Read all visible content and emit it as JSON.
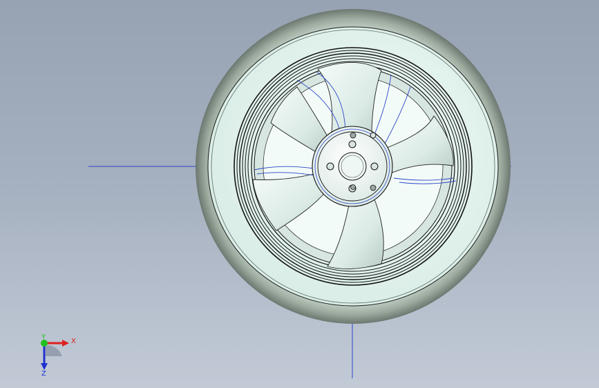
{
  "viewport": {
    "background_top": "#97a2b3",
    "background_bottom": "#c2cad6",
    "axis_line_color": "#2b46c8"
  },
  "model": {
    "part": "wheel-assembly",
    "tire_color": "#8e9a8e",
    "rim_color": "#e6f7f2",
    "edge_color": "#111111",
    "spoke_count": 5,
    "lug_hole_count": 5
  },
  "triad": {
    "x_label": "X",
    "y_label": "Y",
    "z_label": "Z",
    "x_color": "#e02020",
    "y_color": "#20c020",
    "z_color": "#2030d0"
  }
}
